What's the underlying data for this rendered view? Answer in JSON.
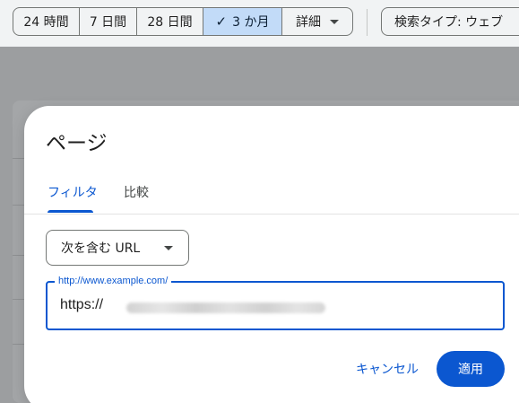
{
  "toolbar": {
    "date_ranges": [
      {
        "label": "24 時間",
        "selected": false
      },
      {
        "label": "7 日間",
        "selected": false
      },
      {
        "label": "28 日間",
        "selected": false
      },
      {
        "label": "3 か月",
        "selected": true
      }
    ],
    "details_label": "詳細",
    "search_type_label": "検索タイプ: ウェブ"
  },
  "dialog": {
    "title": "ページ",
    "tabs": [
      {
        "label": "フィルタ",
        "active": true
      },
      {
        "label": "比較",
        "active": false
      }
    ],
    "match_type": "次を含む URL",
    "url_field": {
      "label": "http://www.example.com/",
      "value": "https://"
    },
    "cancel_label": "キャンセル",
    "apply_label": "適用"
  },
  "colors": {
    "accent": "#0b57d0",
    "selected_segment": "#c2dbf8"
  }
}
